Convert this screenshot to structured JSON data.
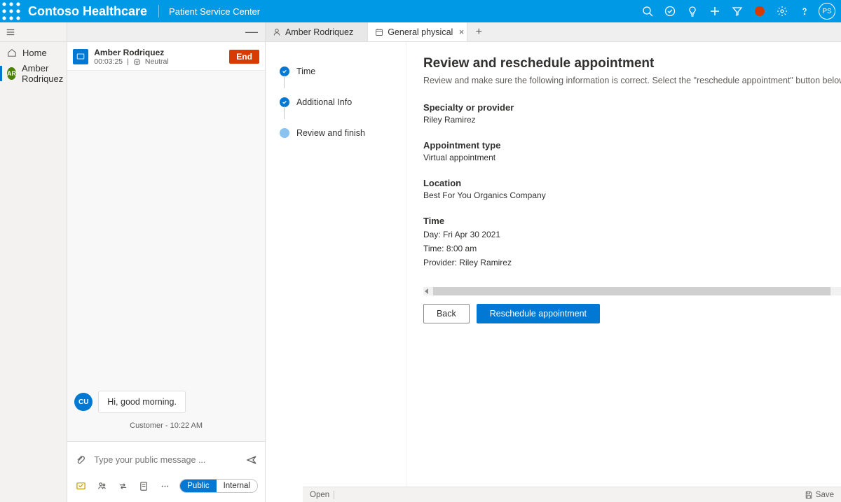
{
  "nav": {
    "title": "Contoso Healthcare",
    "subtitle": "Patient Service Center",
    "avatar_initials": "PS"
  },
  "sidebar": {
    "home_label": "Home",
    "patient_label": "Amber Rodriquez",
    "patient_initials": "AR"
  },
  "conversation": {
    "header_name": "Amber Rodriquez",
    "header_timer": "00:03:25",
    "header_sentiment": "Neutral",
    "end_button": "End",
    "message_avatar": "CU",
    "message_text": "Hi, good morning.",
    "timestamp_line": "Customer - 10:22 AM",
    "input_placeholder": "Type your public message ...",
    "pill_public": "Public",
    "pill_internal": "Internal"
  },
  "tabs": {
    "tab1": "Amber Rodriquez",
    "tab2": "General physical"
  },
  "steps": {
    "s1": "Time",
    "s2": "Additional Info",
    "s3": "Review and finish"
  },
  "detail": {
    "heading": "Review and reschedule appointment",
    "subtext": "Review and make sure the following information is correct. Select the \"reschedule appointment\" button below to update th",
    "specialty_label": "Specialty or provider",
    "specialty_value": "Riley Ramirez",
    "type_label": "Appointment type",
    "type_value": "Virtual appointment",
    "location_label": "Location",
    "location_value": "Best For You Organics Company",
    "time_label": "Time",
    "time_day": "Day: Fri Apr 30 2021",
    "time_time": "Time: 8:00 am",
    "time_provider": "Provider: Riley Ramirez",
    "btn_back": "Back",
    "btn_reschedule": "Reschedule appointment"
  },
  "statusbar": {
    "open": "Open",
    "save": "Save"
  }
}
